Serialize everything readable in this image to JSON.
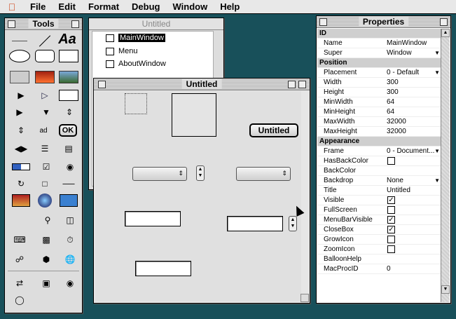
{
  "menubar": {
    "apple_icon": "apple-icon",
    "items": [
      "File",
      "Edit",
      "Format",
      "Debug",
      "Window",
      "Help"
    ]
  },
  "tools_window": {
    "title": "Tools",
    "text_tool_label": "Aa",
    "ok_label": "OK",
    "ad_label": "ad"
  },
  "project_window": {
    "title": "Untitled",
    "items": [
      "MainWindow",
      "Menu",
      "AboutWindow"
    ],
    "selected": "MainWindow"
  },
  "design_window": {
    "title": "Untitled",
    "button_label": "Untitled"
  },
  "properties_window": {
    "title": "Properties",
    "rows": [
      {
        "type": "section",
        "key": "ID"
      },
      {
        "key": "Name",
        "value": "MainWindow"
      },
      {
        "key": "Super",
        "value": "Window",
        "dropdown": true
      },
      {
        "type": "section",
        "key": "Position"
      },
      {
        "key": "Placement",
        "value": "0 - Default",
        "dropdown": true
      },
      {
        "key": "Width",
        "value": "300"
      },
      {
        "key": "Height",
        "value": "300"
      },
      {
        "key": "MinWidth",
        "value": "64"
      },
      {
        "key": "MinHeight",
        "value": "64"
      },
      {
        "key": "MaxWidth",
        "value": "32000"
      },
      {
        "key": "MaxHeight",
        "value": "32000"
      },
      {
        "type": "section",
        "key": "Appearance"
      },
      {
        "key": "Frame",
        "value": "0 - Document...",
        "dropdown": true
      },
      {
        "key": "HasBackColor",
        "check": false
      },
      {
        "key": "BackColor",
        "value": ""
      },
      {
        "key": "Backdrop",
        "value": "None",
        "dropdown": true
      },
      {
        "key": "Title",
        "value": "Untitled"
      },
      {
        "key": "Visible",
        "check": true
      },
      {
        "key": "FullScreen",
        "check": false
      },
      {
        "key": "MenuBarVisible",
        "check": true
      },
      {
        "key": "CloseBox",
        "check": true
      },
      {
        "key": "GrowIcon",
        "check": false
      },
      {
        "key": "ZoomIcon",
        "check": false
      },
      {
        "key": "BalloonHelp",
        "value": ""
      },
      {
        "key": "MacProcID",
        "value": "0"
      }
    ]
  },
  "colors": {
    "desktop": "#18505a",
    "selection": "#000000"
  }
}
